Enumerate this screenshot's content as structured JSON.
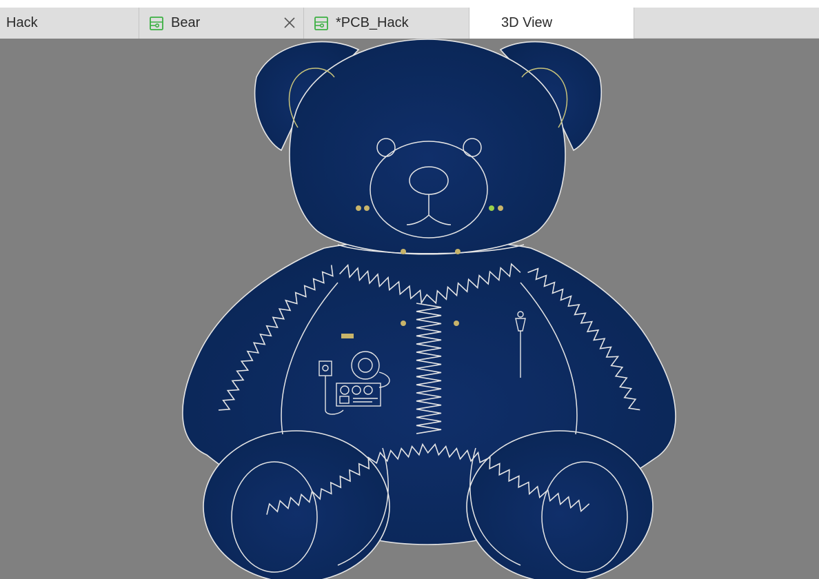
{
  "tabs": [
    {
      "label": "Hack",
      "icon": "none",
      "active": false,
      "closable": false
    },
    {
      "label": "Bear",
      "icon": "pcb-document-icon",
      "active": false,
      "closable": true
    },
    {
      "label": "*PCB_Hack",
      "icon": "pcb-document-icon",
      "active": false,
      "closable": false
    },
    {
      "label": "3D View",
      "icon": "none",
      "active": true,
      "closable": false
    }
  ],
  "viewport": {
    "background": "#808080",
    "board_color": "#0b2a5e",
    "outline_color": "#e8e8e8",
    "pad_color": "#c8b46a",
    "board_name": "Teddy bear PCB (3D render)"
  }
}
